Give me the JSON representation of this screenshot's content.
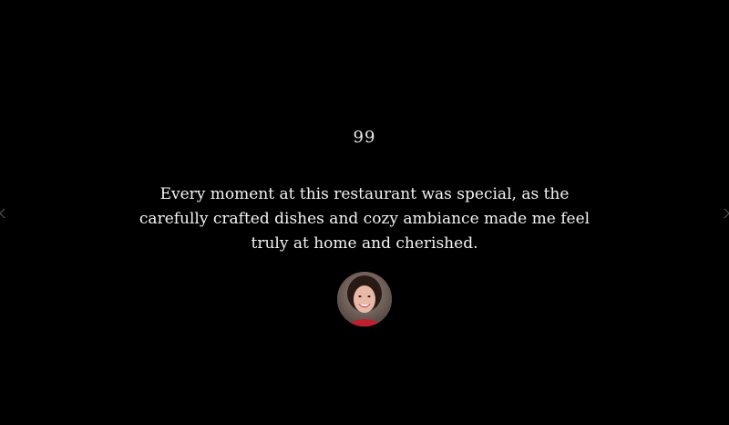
{
  "testimonial": {
    "quote_mark": "99",
    "text": "Every moment at this restaurant was special, as the carefully crafted dishes and cozy ambiance made me feel truly at home and cherished."
  },
  "navigation": {
    "prev_icon": "chevron-left-icon",
    "next_icon": "chevron-right-icon"
  },
  "colors": {
    "background": "#000000",
    "text": "#f4f4f4",
    "arrow": "#555555"
  }
}
